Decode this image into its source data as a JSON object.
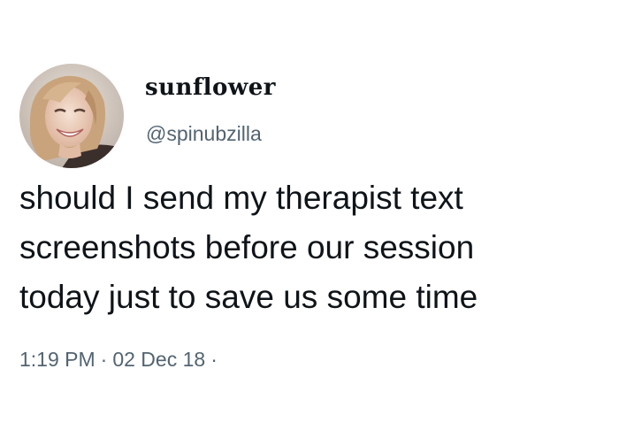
{
  "tweet": {
    "display_name": "sunflower",
    "handle": "@spinubzilla",
    "text_lines": [
      "should I send my therapist text",
      "screenshots before our session",
      "today just to save us some time"
    ],
    "time": "1:19 PM",
    "separator": "·",
    "date": "02 Dec 18",
    "trailing_separator": "·"
  },
  "colors": {
    "background": "#ffffff",
    "text": "#0f1419",
    "secondary_text": "#536471"
  }
}
